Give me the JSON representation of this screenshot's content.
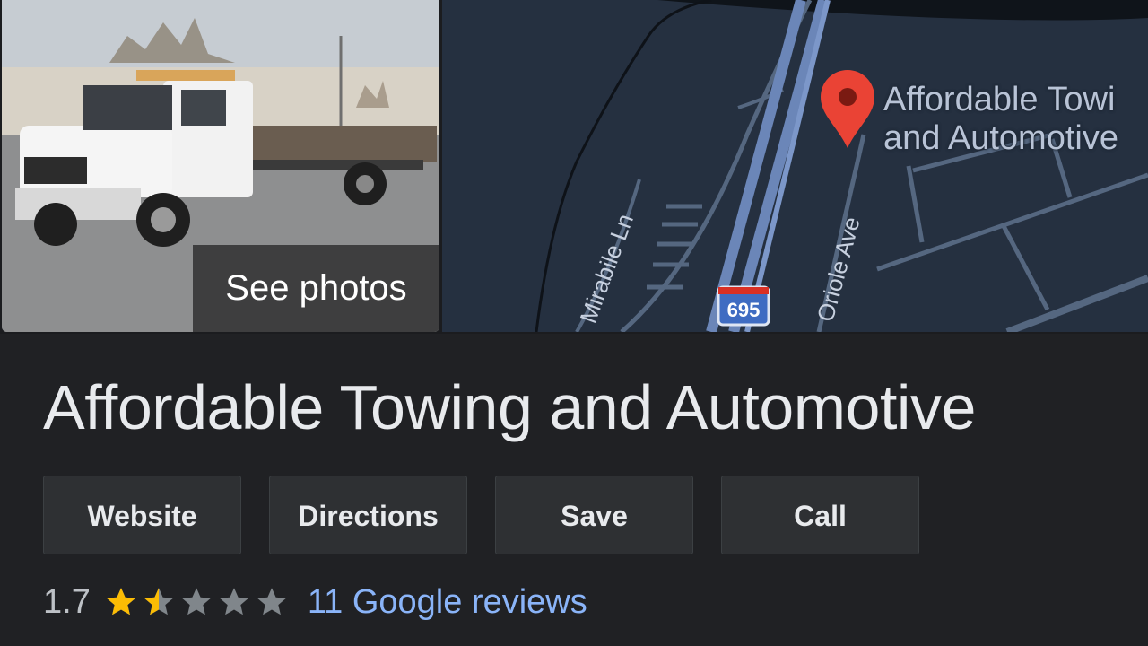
{
  "photo": {
    "see_photos_label": "See photos"
  },
  "map": {
    "place_label_line1": "Affordable Towi",
    "place_label_line2": "and Automotive",
    "streets": [
      "Mirabile Ln",
      "Oriole Ave"
    ],
    "highway_shield": "695",
    "pin_color": "#ea4335"
  },
  "business": {
    "name": "Affordable Towing and Automotive"
  },
  "actions": [
    "Website",
    "Directions",
    "Save",
    "Call"
  ],
  "rating": {
    "value": "1.7",
    "stars_filled": 1.5,
    "stars_total": 5,
    "reviews_link": "11 Google reviews",
    "star_color": "#fbbc04",
    "empty_star_color": "#80868b"
  },
  "colors": {
    "background": "#202124",
    "link": "#8ab4f8",
    "button_bg": "#2e3033"
  }
}
